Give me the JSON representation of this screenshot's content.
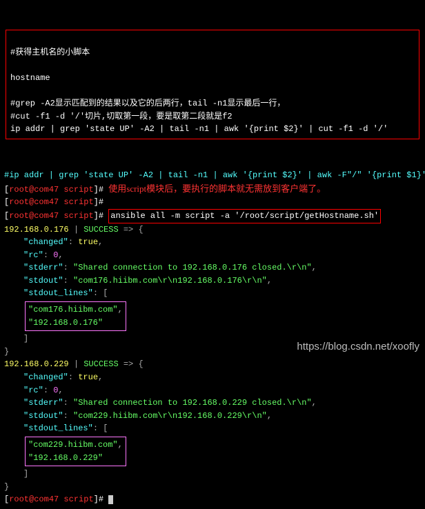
{
  "script_box": {
    "title": "#获得主机名的小脚本",
    "hostname_cmd": "hostname",
    "comment1": "#grep -A2显示匹配到的结果以及它的后两行，tail -n1显示最后一行，",
    "comment2": "#cut -f1 -d '/'切片,切取第一段，要是取第二段就是f2",
    "pipeline": "ip addr | grep 'state UP' -A2 | tail -n1 | awk '{print $2}' | cut -f1 -d '/'"
  },
  "ip_line": "#ip addr | grep 'state UP' -A2 | tail -n1 | awk '{print $2}' | awk -F\"/\" '{print $1}'",
  "prompt": {
    "open": "[",
    "user": "root",
    "at": "@",
    "host": "com47",
    "path": " script",
    "close": "]",
    "hash": "#"
  },
  "annotation": "使用script模块后，要执行的脚本就无需放到客户端了。",
  "command": "ansible all -m script -a '/root/script/getHostname.sh'",
  "result1": {
    "header_ip": "192.168.0.176",
    "bar": " | ",
    "status": "SUCCESS",
    "arrow": " => {",
    "changed_k": "\"changed\"",
    "changed_v": "true",
    "rc_k": "\"rc\"",
    "rc_v": "0",
    "stderr_k": "\"stderr\"",
    "stderr_v": "\"Shared connection to 192.168.0.176 closed.\\r\\n\"",
    "stdout_k": "\"stdout\"",
    "stdout_v": "\"com176.hiibm.com\\r\\n192.168.0.176\\r\\n\"",
    "lines_k": "\"stdout_lines\"",
    "line1": "\"com176.hiibm.com\"",
    "line2": "\"192.168.0.176\""
  },
  "result2": {
    "header_ip": "192.168.0.229",
    "bar": " | ",
    "status": "SUCCESS",
    "arrow": " => {",
    "changed_k": "\"changed\"",
    "changed_v": "true",
    "rc_k": "\"rc\"",
    "rc_v": "0",
    "stderr_k": "\"stderr\"",
    "stderr_v": "\"Shared connection to 192.168.0.229 closed.\\r\\n\"",
    "stdout_k": "\"stdout\"",
    "stdout_v": "\"com229.hiibm.com\\r\\n192.168.0.229\\r\\n\"",
    "lines_k": "\"stdout_lines\"",
    "line1": "\"com229.hiibm.com\"",
    "line2": "\"192.168.0.229\""
  },
  "watermark": "https://blog.csdn.net/xoofly"
}
